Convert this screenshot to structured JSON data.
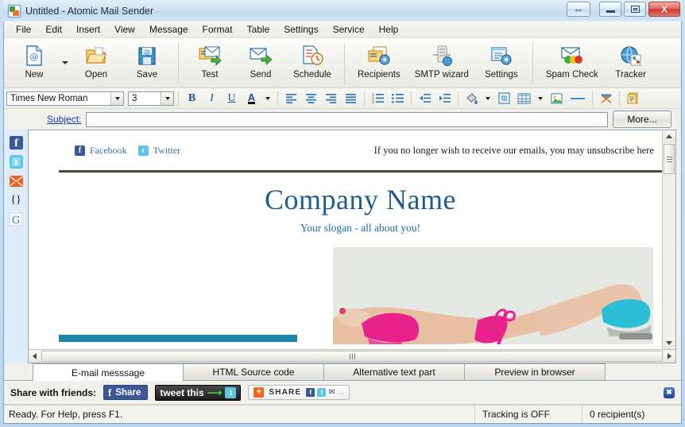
{
  "window": {
    "title": "Untitled - Atomic Mail Sender",
    "icon": "mail-app-icon",
    "buttons": {
      "resize": "resize-arrows-icon",
      "minimize": "minimize-icon",
      "maximize": "maximize-icon",
      "close": "X"
    }
  },
  "menu": {
    "items": [
      {
        "label": "File"
      },
      {
        "label": "Edit"
      },
      {
        "label": "Insert"
      },
      {
        "label": "View"
      },
      {
        "label": "Message"
      },
      {
        "label": "Format"
      },
      {
        "label": "Table"
      },
      {
        "label": "Settings"
      },
      {
        "label": "Service"
      },
      {
        "label": "Help"
      }
    ]
  },
  "toolbar": {
    "groups": [
      {
        "buttons": [
          {
            "label": "New",
            "icon": "new-document-icon",
            "has_dropdown": true
          },
          {
            "label": "Open",
            "icon": "open-folder-icon",
            "has_dropdown": false
          },
          {
            "label": "Save",
            "icon": "floppy-disk-icon",
            "has_dropdown": false
          }
        ]
      },
      {
        "buttons": [
          {
            "label": "Test",
            "icon": "test-envelope-icon",
            "has_dropdown": false
          },
          {
            "label": "Send",
            "icon": "send-envelope-icon",
            "has_dropdown": false
          },
          {
            "label": "Schedule",
            "icon": "schedule-clock-icon",
            "has_dropdown": false
          }
        ]
      },
      {
        "buttons": [
          {
            "label": "Recipients",
            "icon": "recipients-icon",
            "has_dropdown": false
          },
          {
            "label": "SMTP wizard",
            "icon": "smtp-server-icon",
            "has_dropdown": false
          },
          {
            "label": "Settings",
            "icon": "settings-gear-icon",
            "has_dropdown": false
          }
        ]
      },
      {
        "buttons": [
          {
            "label": "Spam Check",
            "icon": "spam-check-icon",
            "has_dropdown": false
          },
          {
            "label": "Tracker",
            "icon": "tracker-globe-icon",
            "has_dropdown": false
          }
        ]
      }
    ]
  },
  "format_bar": {
    "font_family": "Times New Roman",
    "font_size": "3",
    "buttons": [
      {
        "name": "bold",
        "label": "B"
      },
      {
        "name": "italic",
        "label": "I"
      },
      {
        "name": "underline",
        "label": "U"
      },
      {
        "name": "font-color",
        "label": "A"
      },
      {
        "name": "align-left",
        "label": "align-left-icon"
      },
      {
        "name": "align-center",
        "label": "align-center-icon"
      },
      {
        "name": "align-right",
        "label": "align-right-icon"
      },
      {
        "name": "align-justify",
        "label": "align-justify-icon"
      },
      {
        "name": "ordered-list",
        "label": "numbered-list-icon"
      },
      {
        "name": "unordered-list",
        "label": "bullet-list-icon"
      },
      {
        "name": "outdent",
        "label": "decrease-indent-icon"
      },
      {
        "name": "indent",
        "label": "increase-indent-icon"
      },
      {
        "name": "background-color",
        "label": "paint-bucket-icon"
      },
      {
        "name": "insert-link",
        "label": "insert-link-icon"
      },
      {
        "name": "insert-table",
        "label": "insert-table-icon"
      },
      {
        "name": "insert-image",
        "label": "insert-image-icon"
      },
      {
        "name": "horizontal-rule",
        "label": "horizontal-line-icon"
      },
      {
        "name": "remove-link",
        "label": "remove-link-icon"
      },
      {
        "name": "insert-template",
        "label": "template-icon"
      }
    ]
  },
  "subject": {
    "label": "Subject:",
    "value": "",
    "placeholder": "",
    "more_label": "More..."
  },
  "left_rail": {
    "items": [
      {
        "name": "facebook-icon",
        "label": "f"
      },
      {
        "name": "twitter-icon",
        "label": "t"
      },
      {
        "name": "email-icon",
        "label": "mail"
      },
      {
        "name": "macro-icon",
        "label": "{}"
      },
      {
        "name": "google-icon",
        "label": "G"
      }
    ]
  },
  "email_template": {
    "social_links": [
      {
        "label": "Facebook",
        "icon": "facebook-icon"
      },
      {
        "label": "Twitter",
        "icon": "twitter-icon"
      }
    ],
    "unsubscribe_text": "If you no longer wish to receive our emails, you may unsubscribe here",
    "company_name": "Company Name",
    "slogan": "Your slogan - all about you!",
    "hero_image_alt": "woman-in-pink-bikini-spa-photo",
    "colors": {
      "heading": "#1f5c8f",
      "slogan": "#1f6ba8",
      "rule": "#4a4b38",
      "accent_bar": "#1b86a8"
    }
  },
  "tabs": [
    {
      "label": "E-mail messsage",
      "active": true
    },
    {
      "label": "HTML Source code",
      "active": false
    },
    {
      "label": "Alternative text part",
      "active": false
    },
    {
      "label": "Preview in browser",
      "active": false
    }
  ],
  "share_bar": {
    "label": "Share with friends:",
    "facebook": {
      "label": "Share",
      "icon": "facebook-f-icon"
    },
    "twitter": {
      "label": "tweet this",
      "icon": "twitter-bird-icon"
    },
    "addthis": {
      "label": "SHARE",
      "icon": "addthis-plus-icon",
      "mini": [
        "facebook-icon",
        "twitter-icon",
        "email-icon"
      ],
      "more": "..."
    },
    "corner_button": "collapse-panel-icon"
  },
  "status_bar": {
    "message": "Ready. For Help, press F1.",
    "tracking": "Tracking is OFF",
    "recipients": "0 recipient(s)"
  }
}
